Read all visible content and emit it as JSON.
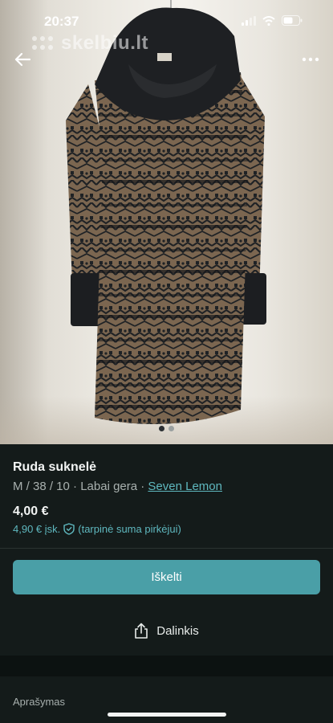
{
  "status_bar": {
    "time": "20:37",
    "icons": [
      "signal-icon",
      "wifi-icon",
      "battery-icon"
    ]
  },
  "watermark": {
    "text": "skelbiu.lt"
  },
  "top_bar": {
    "back_icon": "arrow-left-icon",
    "more_icon": "more-horizontal-icon"
  },
  "gallery": {
    "total_images": 2,
    "active_index": 1
  },
  "listing": {
    "title": "Ruda suknelė",
    "size_condition": "M / 38 / 10 · Labai gera · ",
    "brand": "Seven Lemon",
    "price": "4,00 €",
    "price_incl": "4,90 € įsk.",
    "protection_note": "(tarpinė suma pirkėjui)"
  },
  "actions": {
    "buy_label": "Iškelti",
    "share_label": "Dalinkis"
  },
  "description": {
    "title": "Aprašymas"
  },
  "colors": {
    "background": "#141b1a",
    "accent": "#4a9fa7",
    "link": "#5fb8bf"
  }
}
